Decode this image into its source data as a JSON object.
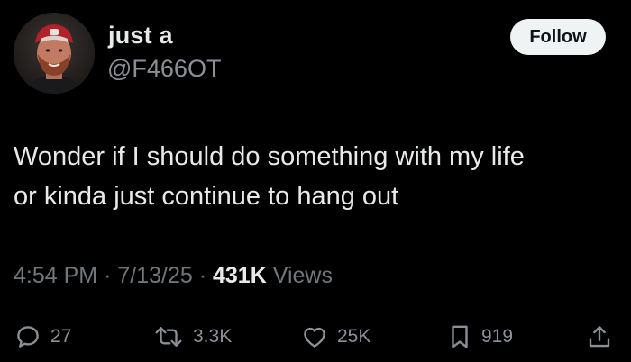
{
  "user": {
    "display_name": "just a",
    "handle": "@F466OT"
  },
  "follow_label": "Follow",
  "tweet": {
    "text_lines": [
      "Wonder if I should do something with my life",
      "or kinda just continue to hang out"
    ]
  },
  "meta": {
    "time": "4:54 PM",
    "separator": "·",
    "date": "7/13/25",
    "views_count": "431K",
    "views_label": "Views"
  },
  "actions": {
    "replies": "27",
    "reposts": "3.3K",
    "likes": "25K",
    "bookmarks": "919"
  },
  "icons": {
    "reply": "reply-icon",
    "repost": "repost-icon",
    "like": "heart-icon",
    "bookmark": "bookmark-icon",
    "share": "share-icon"
  },
  "colors": {
    "background": "#000000",
    "text": "#e7e9ea",
    "secondary": "#71767b",
    "follow_bg": "#eff3f4"
  }
}
